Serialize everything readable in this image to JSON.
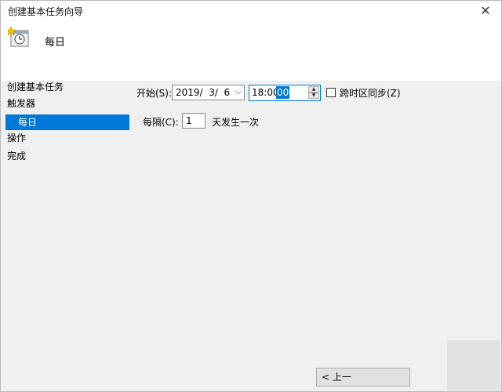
{
  "window": {
    "title": "创建基本任务向导",
    "close_glyph": "✕"
  },
  "header": {
    "title": "每日",
    "icon": "clock-calendar-icon"
  },
  "sidebar": {
    "items": [
      {
        "label": "创建基本任务"
      },
      {
        "label": "触发器"
      },
      {
        "label": "每日",
        "selected": true
      },
      {
        "label": "操作"
      },
      {
        "label": "完成"
      }
    ]
  },
  "form": {
    "start_label": "开始(S):",
    "date_value": "2019/  3/  6",
    "date_arrow": "⌵",
    "time_prefix": "18:00:",
    "time_selected": "00",
    "sync_label": "跨时区同步(Z)",
    "recur_label": "每隔(C):",
    "recur_value": "1",
    "recur_suffix": "天发生一次"
  },
  "footer": {
    "prev_label": "< 上一"
  }
}
